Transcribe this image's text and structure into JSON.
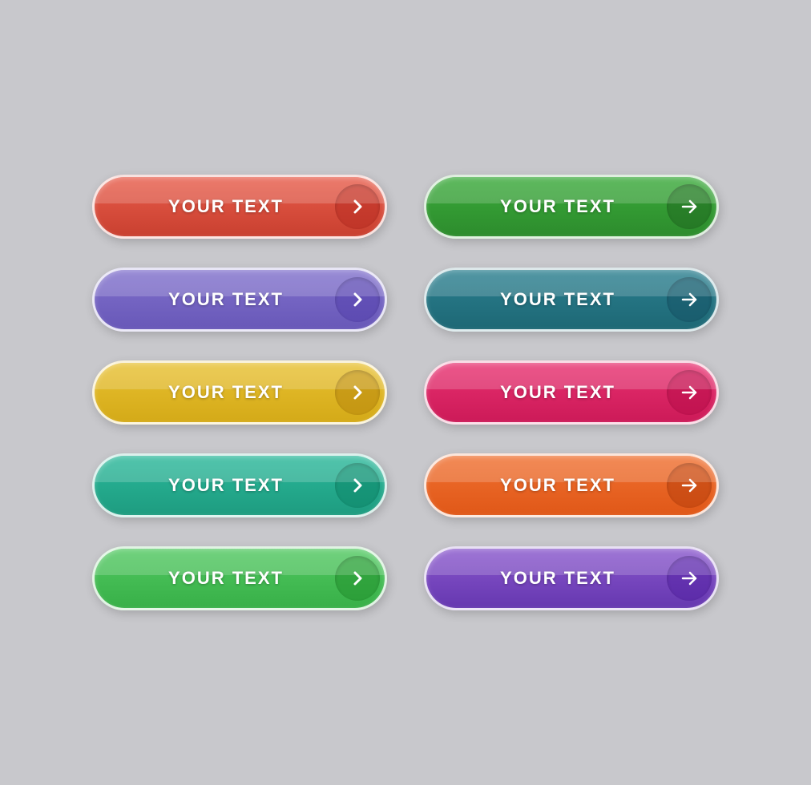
{
  "buttons": [
    {
      "id": "btn-red",
      "label": "YOUR TEXT",
      "color_class": "btn-red",
      "icon_type": "chevron",
      "col": "left"
    },
    {
      "id": "btn-green",
      "label": "YOUR TEXT",
      "color_class": "btn-green",
      "icon_type": "arrow",
      "col": "right"
    },
    {
      "id": "btn-purple",
      "label": "YOUR TEXT",
      "color_class": "btn-purple",
      "icon_type": "chevron",
      "col": "left"
    },
    {
      "id": "btn-teal-dark",
      "label": "YOUR TEXT",
      "color_class": "btn-teal-dark",
      "icon_type": "arrow",
      "col": "right"
    },
    {
      "id": "btn-yellow",
      "label": "YOUR TEXT",
      "color_class": "btn-yellow",
      "icon_type": "chevron",
      "col": "left"
    },
    {
      "id": "btn-pink",
      "label": "YOUR TEXT",
      "color_class": "btn-pink",
      "icon_type": "arrow",
      "col": "right"
    },
    {
      "id": "btn-teal",
      "label": "YOUR TEXT",
      "color_class": "btn-teal",
      "icon_type": "chevron",
      "col": "left"
    },
    {
      "id": "btn-orange",
      "label": "YOUR TEXT",
      "color_class": "btn-orange",
      "icon_type": "arrow",
      "col": "right"
    },
    {
      "id": "btn-green2",
      "label": "YOUR TEXT",
      "color_class": "btn-green2",
      "icon_type": "chevron",
      "col": "left"
    },
    {
      "id": "btn-violet",
      "label": "YOUR TEXT",
      "color_class": "btn-violet",
      "icon_type": "arrow",
      "col": "right"
    }
  ]
}
